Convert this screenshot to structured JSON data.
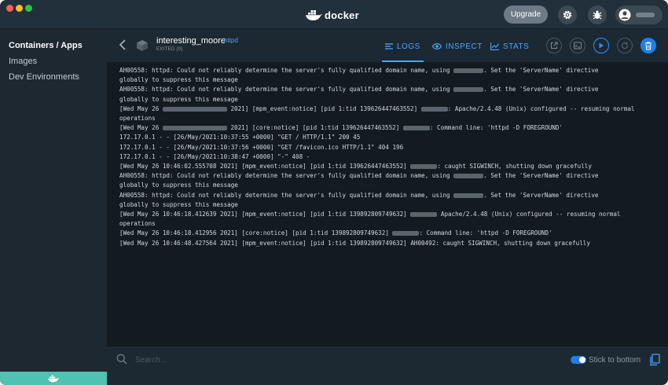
{
  "titlebar": {
    "brand": "docker",
    "upgrade_label": "Upgrade"
  },
  "sidebar": {
    "items": [
      {
        "label": "Containers / Apps",
        "active": true
      },
      {
        "label": "Images",
        "active": false
      },
      {
        "label": "Dev Environments",
        "active": false
      }
    ]
  },
  "container": {
    "name": "interesting_moore",
    "image": "httpd",
    "status": "EXITED (0)"
  },
  "tabs": [
    {
      "label": "LOGS",
      "icon": "list-icon",
      "active": true
    },
    {
      "label": "INSPECT",
      "icon": "eye-icon",
      "active": false
    },
    {
      "label": "STATS",
      "icon": "chart-icon",
      "active": false
    }
  ],
  "logs": [
    {
      "a": "AH00558: httpd: Could not reliably determine the server's fully qualified domain name, using ",
      "b": ". Set the 'ServerName' directive"
    },
    {
      "a": "globally to suppress this message"
    },
    {
      "a": "AH00558: httpd: Could not reliably determine the server's fully qualified domain name, using ",
      "b": ". Set the 'ServerName' directive"
    },
    {
      "a": "globally to suppress this message"
    },
    {
      "a": "[Wed May 26 ",
      "b": " 2021] [mpm_event:notice] [pid 1:tid 139626447463552] ",
      "c": ": Apache/2.4.48 (Unix) configured -- resuming normal"
    },
    {
      "a": "operations"
    },
    {
      "a": "[Wed May 26 ",
      "b": " 2021] [core:notice] [pid 1:tid 139626447463552] ",
      "c": ": Command line: 'httpd -D FOREGROUND'"
    },
    {
      "a": "172.17.0.1 - - [26/May/2021:10:37:55 +0000] \"GET / HTTP/1.1\" 200 45"
    },
    {
      "a": "172.17.0.1 - - [26/May/2021:10:37:56 +0000] \"GET /favicon.ico HTTP/1.1\" 404 196"
    },
    {
      "a": "172.17.0.1 - - [26/May/2021:10:38:47 +0000] \"-\" 408 -"
    },
    {
      "a": "[Wed May 26 10:46:02.555708 2021] [mpm_event:notice] [pid 1:tid 139626447463552] ",
      "b": ": caught SIGWINCH, shutting down gracefully"
    },
    {
      "a": "AH00558: httpd: Could not reliably determine the server's fully qualified domain name, using ",
      "b": ". Set the 'ServerName' directive"
    },
    {
      "a": "globally to suppress this message"
    },
    {
      "a": "AH00558: httpd: Could not reliably determine the server's fully qualified domain name, using ",
      "b": ". Set the 'ServerName' directive"
    },
    {
      "a": "globally to suppress this message"
    },
    {
      "a": "[Wed May 26 10:46:18.412639 2021] [mpm_event:notice] [pid 1:tid 139892809749632] ",
      "b": " Apache/2.4.48 (Unix) configured -- resuming normal"
    },
    {
      "a": "operations"
    },
    {
      "a": "[Wed May 26 10:46:18.412956 2021] [core:notice] [pid 1:tid 139892809749632] ",
      "b": ": Command line: 'httpd -D FOREGROUND'"
    },
    {
      "a": "[Wed May 26 10:46:48.427564 2021] [mpm_event:notice] [pid 1:tid 139892809749632] AH00492: caught SIGWINCH, shutting down gracefully"
    }
  ],
  "footer": {
    "search_placeholder": "Search...",
    "stick_label": "Stick to bottom",
    "stick_enabled": true
  },
  "colors": {
    "accent": "#4aa3ff",
    "sidebar_footer": "#4fc2b1"
  }
}
